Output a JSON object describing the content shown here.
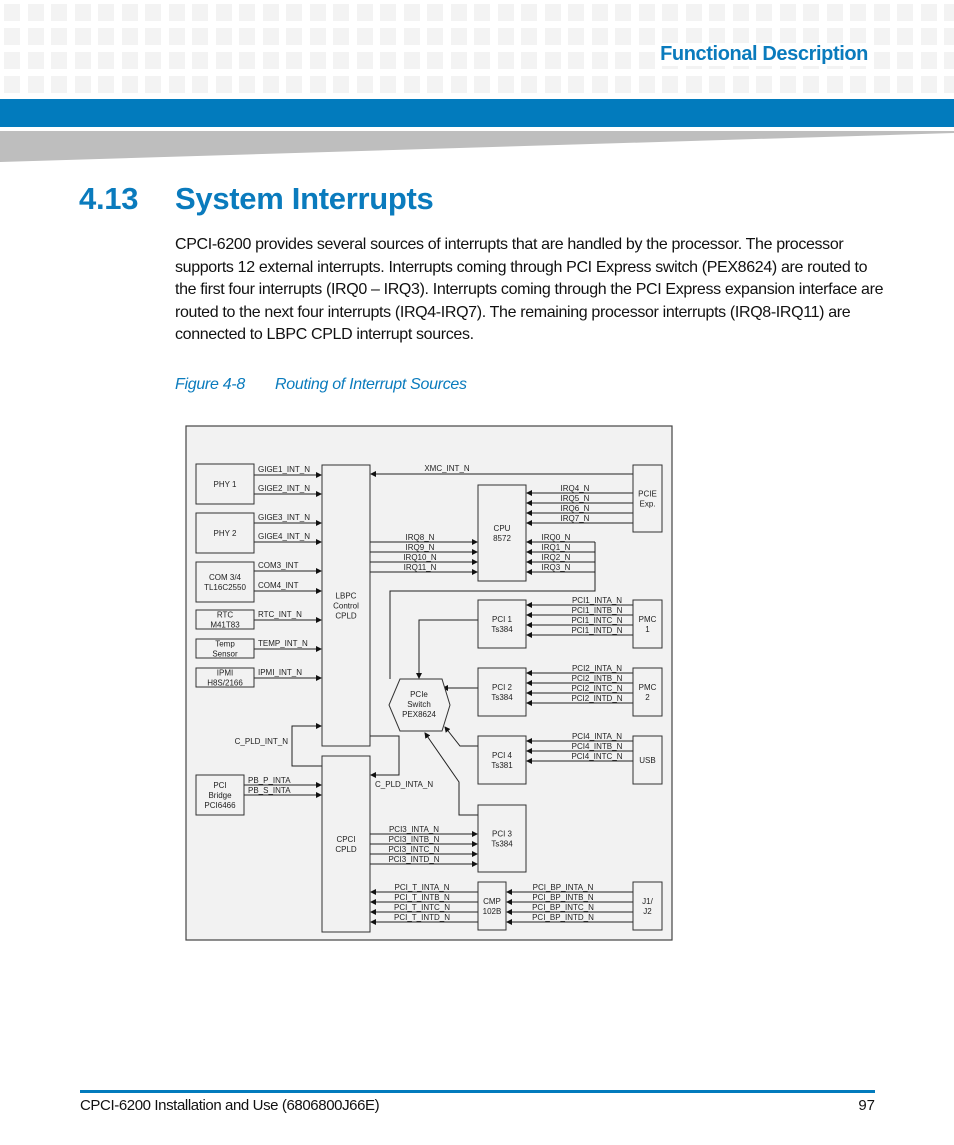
{
  "header": {
    "section_label": "Functional Description",
    "colors": {
      "brand_blue": "#027bbd",
      "heading_blue": "#0a7bbd",
      "wedge_grey": "#bebebe"
    }
  },
  "section": {
    "number": "4.13",
    "title": "System Interrupts",
    "paragraph": "CPCI-6200 provides several sources of interrupts that are handled by the processor. The processor supports 12 external interrupts. Interrupts coming through PCI Express switch (PEX8624) are routed to the first four interrupts (IRQ0 – IRQ3). Interrupts coming through the PCI Express expansion interface are routed to the next four interrupts (IRQ4-IRQ7). The remaining processor interrupts (IRQ8-IRQ11) are connected to LBPC CPLD interrupt sources."
  },
  "figure": {
    "number": "Figure 4-8",
    "title": "Routing of Interrupt Sources"
  },
  "diagram": {
    "blocks": {
      "phy1": [
        "PHY 1"
      ],
      "phy2": [
        "PHY 2"
      ],
      "com": [
        "COM 3/4",
        "TL16C2550"
      ],
      "rtc": [
        "RTC",
        "M41T83"
      ],
      "temp": [
        "Temp",
        "Sensor"
      ],
      "ipmi": [
        "IPMI",
        "H8S/2166"
      ],
      "pci_bridge": [
        "PCI",
        "Bridge",
        "PCI6466"
      ],
      "lbpc": [
        "LBPC",
        "Control",
        "CPLD"
      ],
      "cpci_cpld": [
        "CPCI",
        "CPLD"
      ],
      "cpu": [
        "CPU",
        "8572"
      ],
      "pcie_exp": [
        "PCIE",
        "Exp."
      ],
      "pcie_switch": [
        "PCIe",
        "Switch",
        "PEX8624"
      ],
      "pci1": [
        "PCI 1",
        "Ts384"
      ],
      "pci2": [
        "PCI 2",
        "Ts384"
      ],
      "pci4": [
        "PCI 4",
        "Ts381"
      ],
      "pci3": [
        "PCI 3",
        "Ts384"
      ],
      "pmc1": [
        "PMC",
        "1"
      ],
      "pmc2": [
        "PMC",
        "2"
      ],
      "usb": [
        "USB"
      ],
      "cmp": [
        "CMP",
        "102B"
      ],
      "j1j2": [
        "J1/",
        "J2"
      ]
    },
    "signals": {
      "phy1": [
        "GIGE1_INT_N",
        "GIGE2_INT_N"
      ],
      "phy2": [
        "GIGE3_INT_N",
        "GIGE4_INT_N"
      ],
      "com": [
        "COM3_INT",
        "COM4_INT"
      ],
      "rtc": "RTC_INT_N",
      "temp": "TEMP_INT_N",
      "ipmi": "IPMI_INT_N",
      "xmc": "XMC_INT_N",
      "irq_exp": [
        "IRQ4_N",
        "IRQ5_N",
        "IRQ6_N",
        "IRQ7_N"
      ],
      "irq_lbpc": [
        "IRQ8_N",
        "IRQ9_N",
        "IRQ10_N",
        "IRQ11_N"
      ],
      "irq_switch": [
        "IRQ0_N",
        "IRQ1_N",
        "IRQ2_N",
        "IRQ3_N"
      ],
      "pci1": [
        "PCI1_INTA_N",
        "PCI1_INTB_N",
        "PCI1_INTC_N",
        "PCI1_INTD_N"
      ],
      "pci2": [
        "PCI2_INTA_N",
        "PCI2_INTB_N",
        "PCI2_INTC_N",
        "PCI2_INTD_N"
      ],
      "pci4": [
        "PCI4_INTA_N",
        "PCI4_INTB_N",
        "PCI4_INTC_N"
      ],
      "c_pld_int": "C_PLD_INT_N",
      "c_pld_inta": "C_PLD_INTA_N",
      "pb": [
        "PB_P_INTA",
        "PB_S_INTA"
      ],
      "pci3": [
        "PCI3_INTA_N",
        "PCI3_INTB_N",
        "PCI3_INTC_N",
        "PCI3_INTD_N"
      ],
      "pci_t": [
        "PCI_T_INTA_N",
        "PCI_T_INTB_N",
        "PCI_T_INTC_N",
        "PCI_T_INTD_N"
      ],
      "pci_bp": [
        "PCI_BP_INTA_N",
        "PCI_BP_INTB_N",
        "PCI_BP_INTC_N",
        "PCI_BP_INTD_N"
      ]
    }
  },
  "footer": {
    "doc_title": "CPCI-6200 Installation and Use (6806800J66E)",
    "page_number": "97"
  }
}
